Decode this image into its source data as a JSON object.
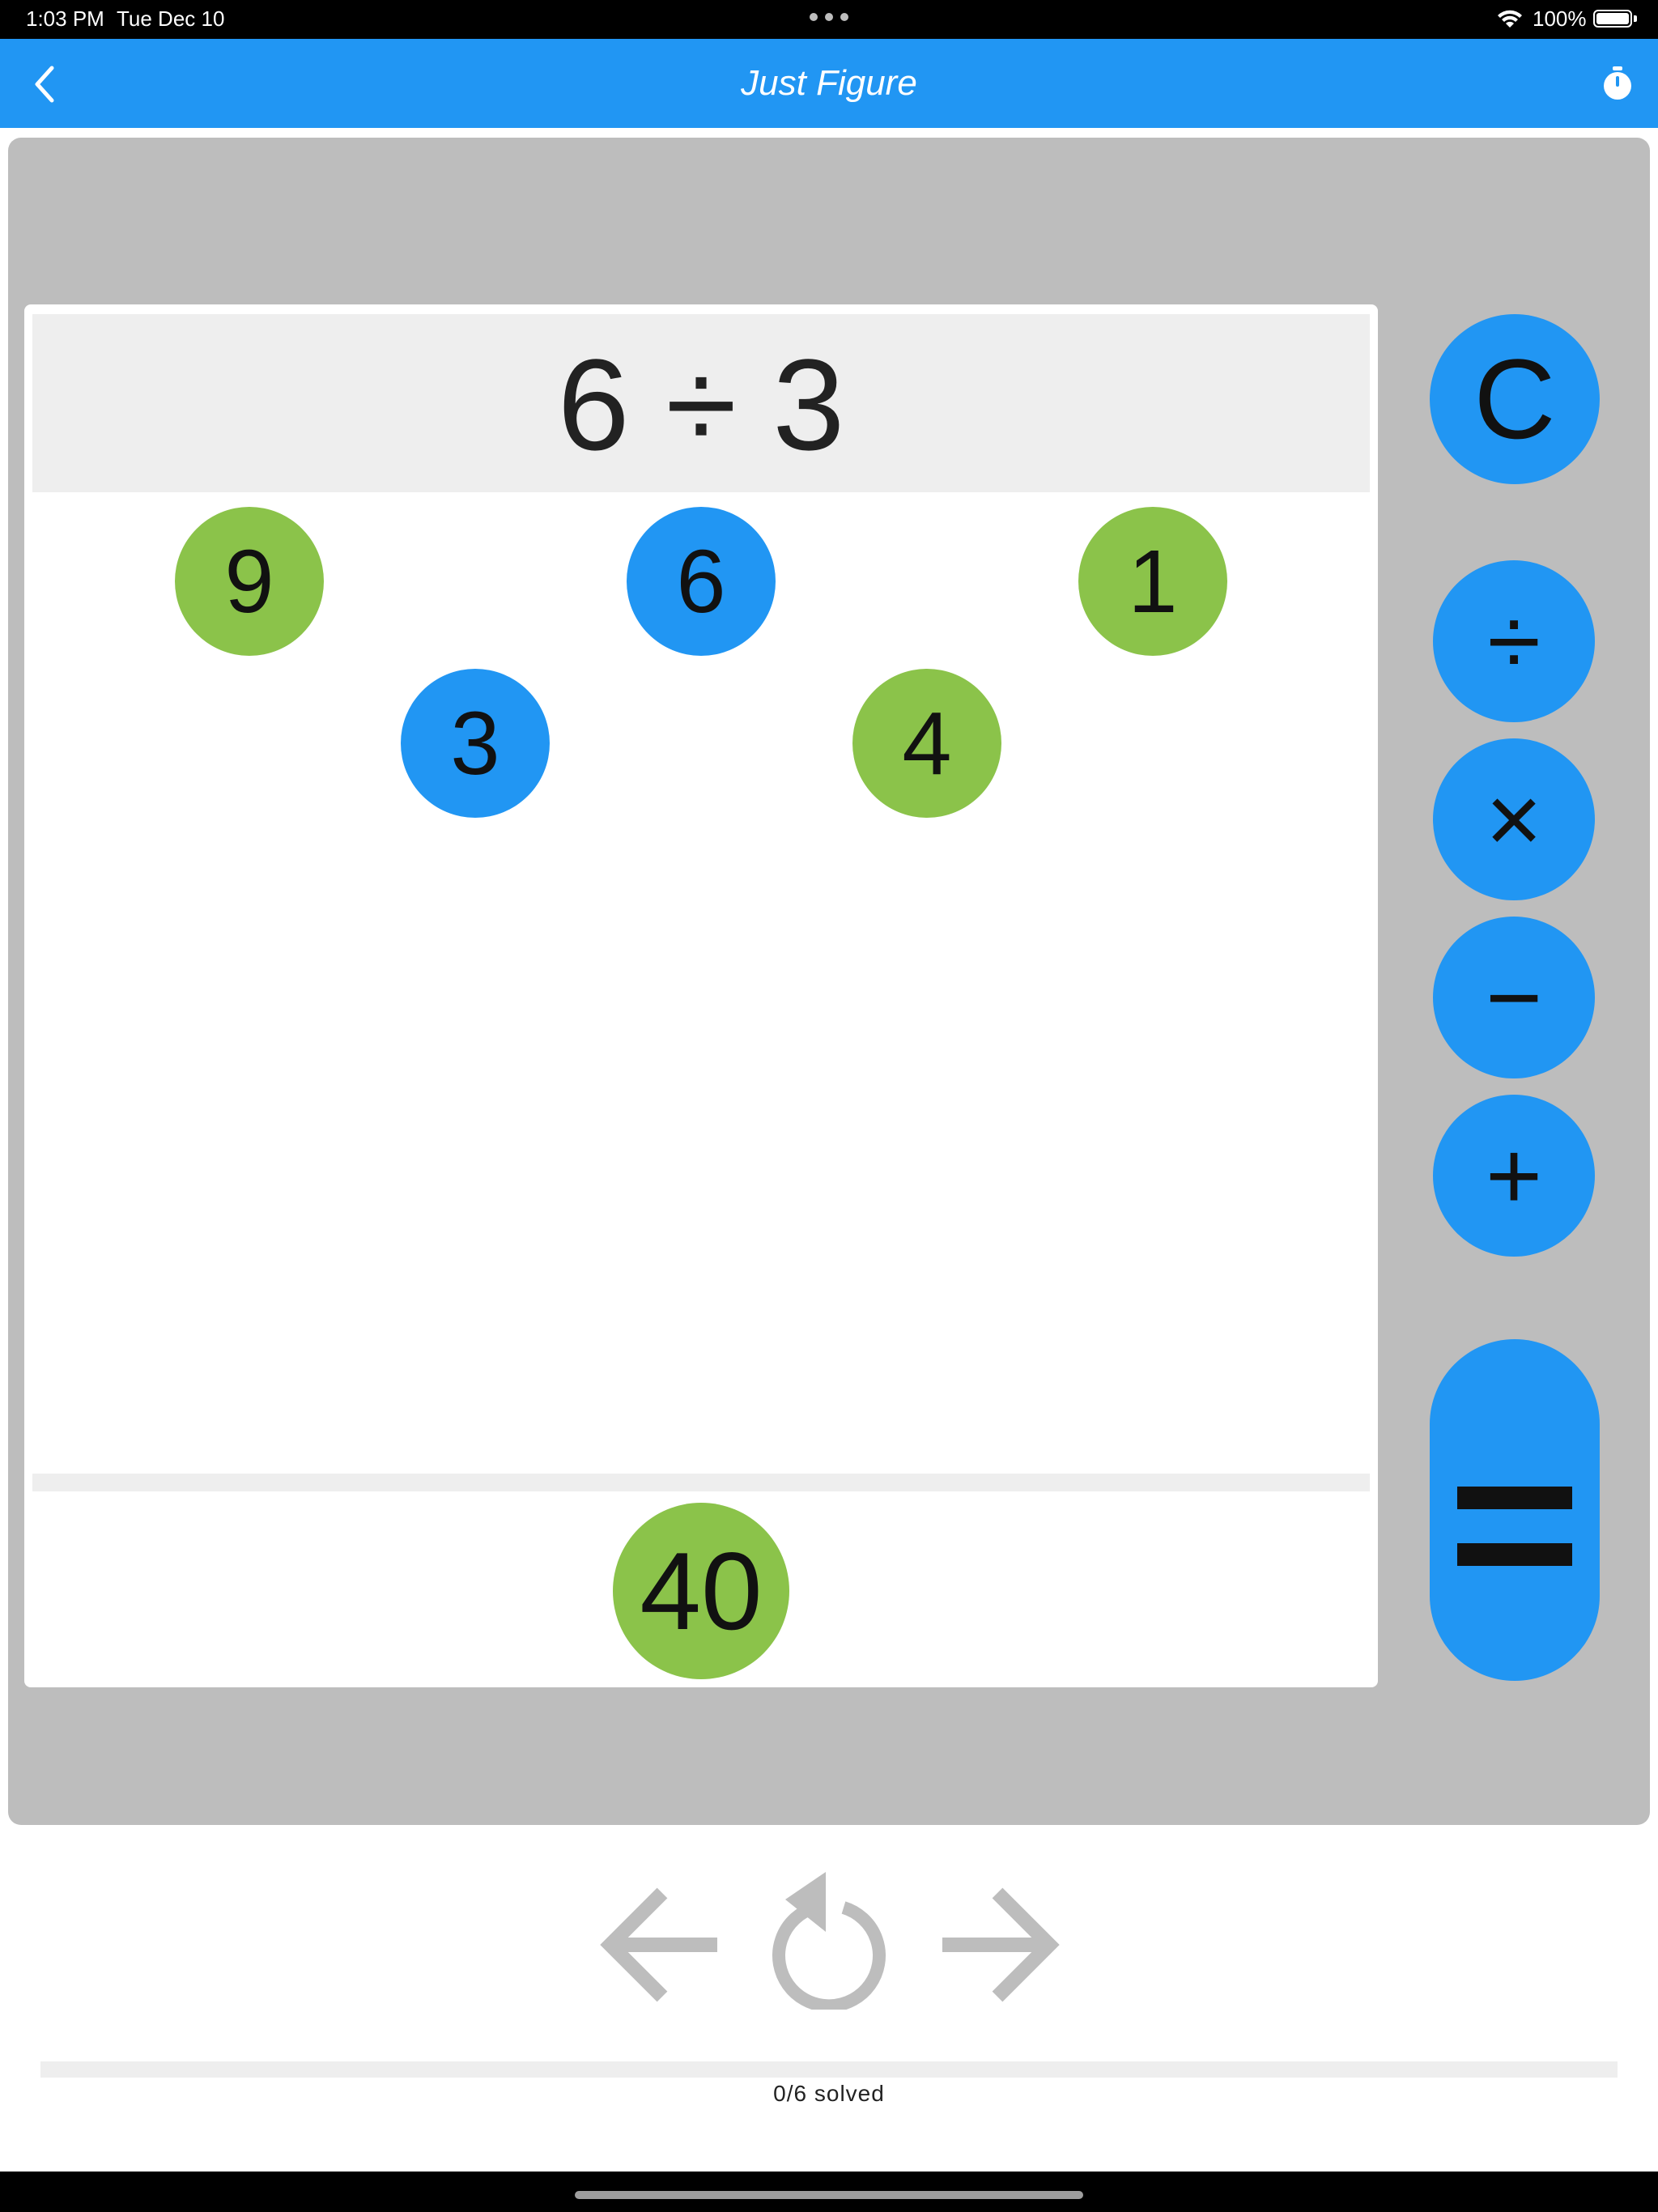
{
  "status_bar": {
    "time": "1:03 PM",
    "date": "Tue Dec 10",
    "battery": "100%"
  },
  "nav": {
    "title": "Just Figure",
    "back_icon": "chevron-left-icon",
    "timer_icon": "stopwatch-icon"
  },
  "expression": "6 ÷ 3",
  "numbers": [
    {
      "label": "9",
      "color": "#8bc34a"
    },
    {
      "label": "6",
      "color": "#2196f3"
    },
    {
      "label": "1",
      "color": "#8bc34a"
    },
    {
      "label": "3",
      "color": "#2196f3"
    },
    {
      "label": "4",
      "color": "#8bc34a"
    }
  ],
  "target": {
    "label": "40",
    "color": "#8bc34a"
  },
  "operators": {
    "clear": "C",
    "divide": "÷",
    "multiply": "×",
    "subtract": "−",
    "add": "+"
  },
  "progress": {
    "label": "0/6 solved",
    "solved": 0,
    "total": 6
  },
  "colors": {
    "accent": "#2196f3",
    "green": "#8bc34a",
    "panel": "#bdbdbd",
    "control_gray": "#bdbdbd"
  }
}
